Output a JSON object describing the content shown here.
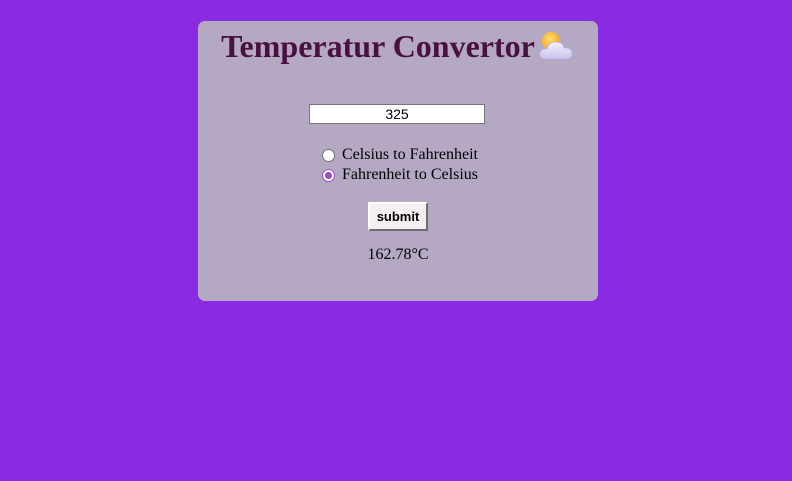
{
  "app": {
    "title": "Temperatur Convertor",
    "title_icon": "sun-behind-cloud-icon"
  },
  "converter": {
    "input_value": "325",
    "options": [
      {
        "label": "Celsius to Fahrenheit",
        "checked": false
      },
      {
        "label": "Fahrenheit to Celsius",
        "checked": true
      }
    ],
    "submit_label": "submit",
    "result": "162.78°C"
  },
  "colors": {
    "page_background": "#8a2be2",
    "card_background": "#b4a8c2",
    "title_color": "#4a1042",
    "radio_accent": "#9b4dca"
  }
}
